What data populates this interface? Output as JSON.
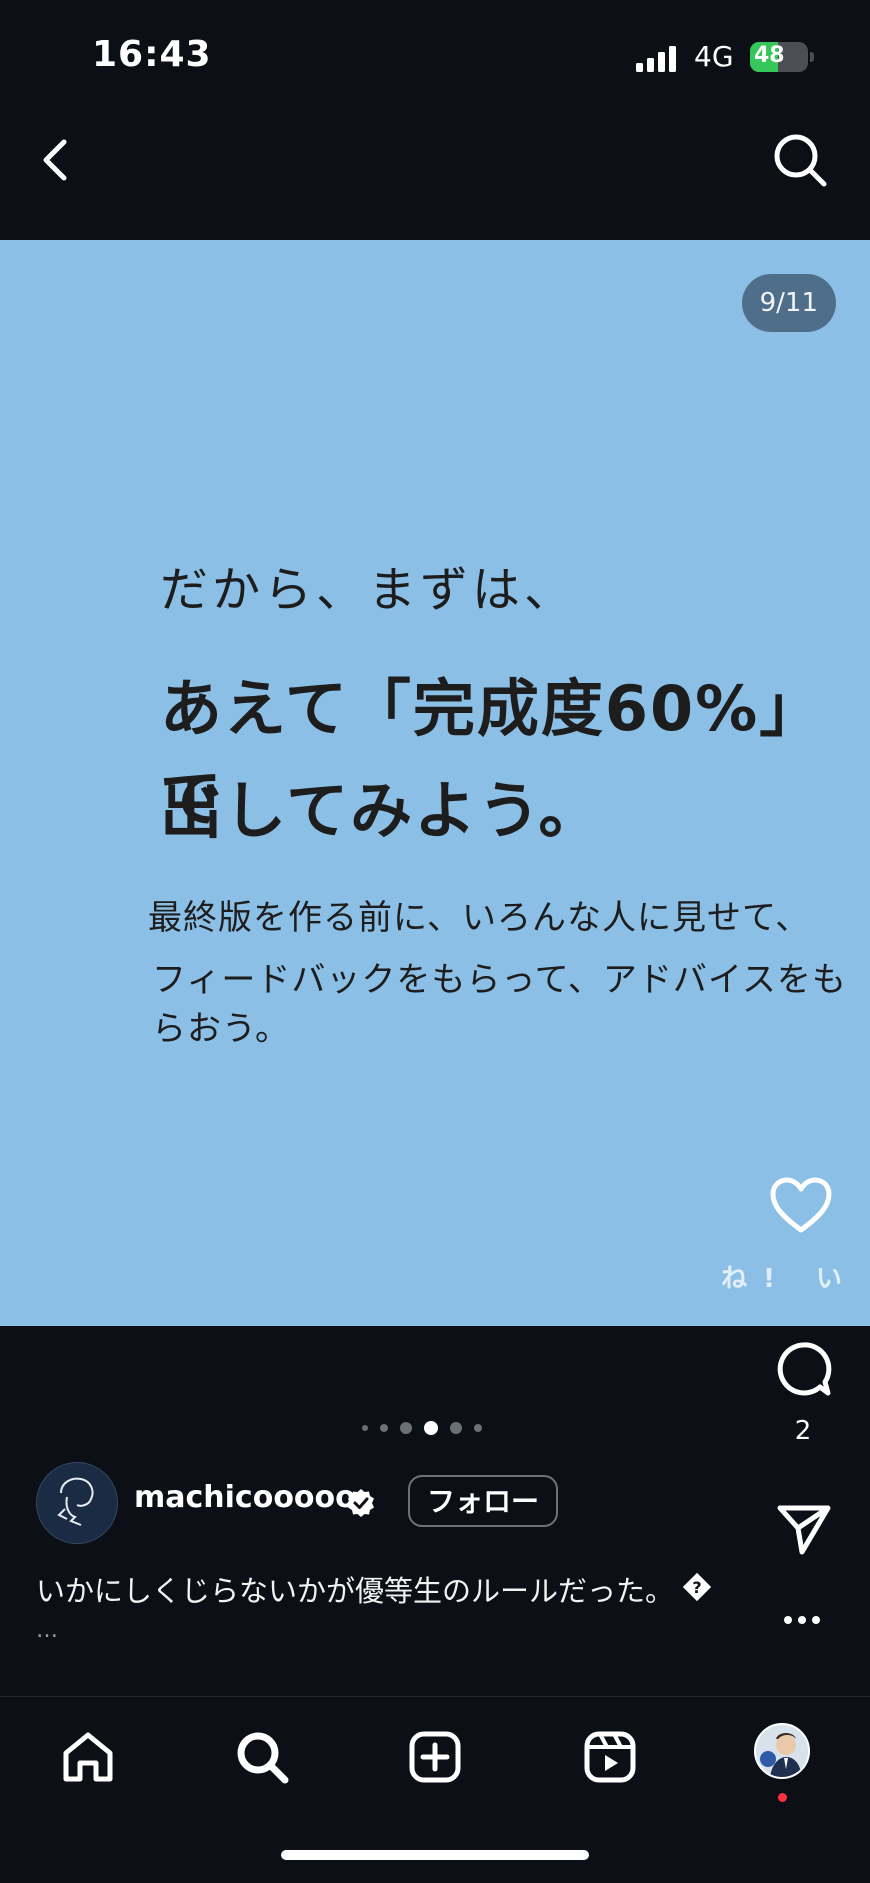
{
  "status_bar": {
    "time": "16:43",
    "network": "4G",
    "battery": "48",
    "battery_level": 0.48
  },
  "header": {
    "back_icon": "chevron-left-icon",
    "search_icon": "search-icon"
  },
  "post": {
    "page_indicator": "9/11",
    "text_line1": "だから、まずは、",
    "text_line2": "あえて「完成度60%」で",
    "text_line3": "出してみよう。",
    "sub_line1": "最終版を作る前に、いろんな人に見せて、",
    "sub_line2": "フィードバックをもらって、アドバイスをもらおう。",
    "stamp": "ね! い"
  },
  "actions": {
    "comment_count": "2"
  },
  "carousel": {
    "dot_count": 6,
    "active_index": 4
  },
  "account": {
    "username": "machicooooo",
    "follow_label": "フォロー"
  },
  "caption": {
    "text": "いかにしくじらないかが優等生のルールだった。",
    "more": "…"
  },
  "colors": {
    "background": "#0c1016",
    "post_bg": "#8bbfe6",
    "accent_red": "#ff3040",
    "battery_green": "#35c759"
  }
}
